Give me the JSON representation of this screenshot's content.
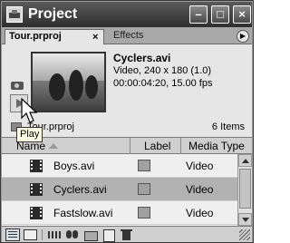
{
  "window": {
    "title": "Project"
  },
  "tabs": [
    {
      "label": "Tour.prproj",
      "close": "×",
      "active": true
    },
    {
      "label": "Effects",
      "active": false
    }
  ],
  "preview": {
    "clip_name": "Cyclers.avi",
    "clip_info": [
      "Video, 240 x 180 (1.0)",
      "00:00:04:20, 15.00 fps"
    ]
  },
  "bin": {
    "name": "Tour.prproj",
    "item_count": "6 Items"
  },
  "tooltip": "Play",
  "columns": {
    "name": "Name",
    "label": "Label",
    "media_type": "Media Type"
  },
  "rows": [
    {
      "name": "Boys.avi",
      "media_type": "Video",
      "selected": false
    },
    {
      "name": "Cyclers.avi",
      "media_type": "Video",
      "selected": true
    },
    {
      "name": "Fastslow.avi",
      "media_type": "Video",
      "selected": false
    }
  ],
  "icons": {
    "app": "project-window-icon",
    "poster": "camera-icon",
    "play": "play-icon",
    "clip": "film-icon"
  },
  "colors": {
    "title_bar": "#3a3a3a",
    "panel_bg": "#e6e6e6",
    "selected_row": "#b2b2b2",
    "label_swatch": "#a0a0a0"
  }
}
